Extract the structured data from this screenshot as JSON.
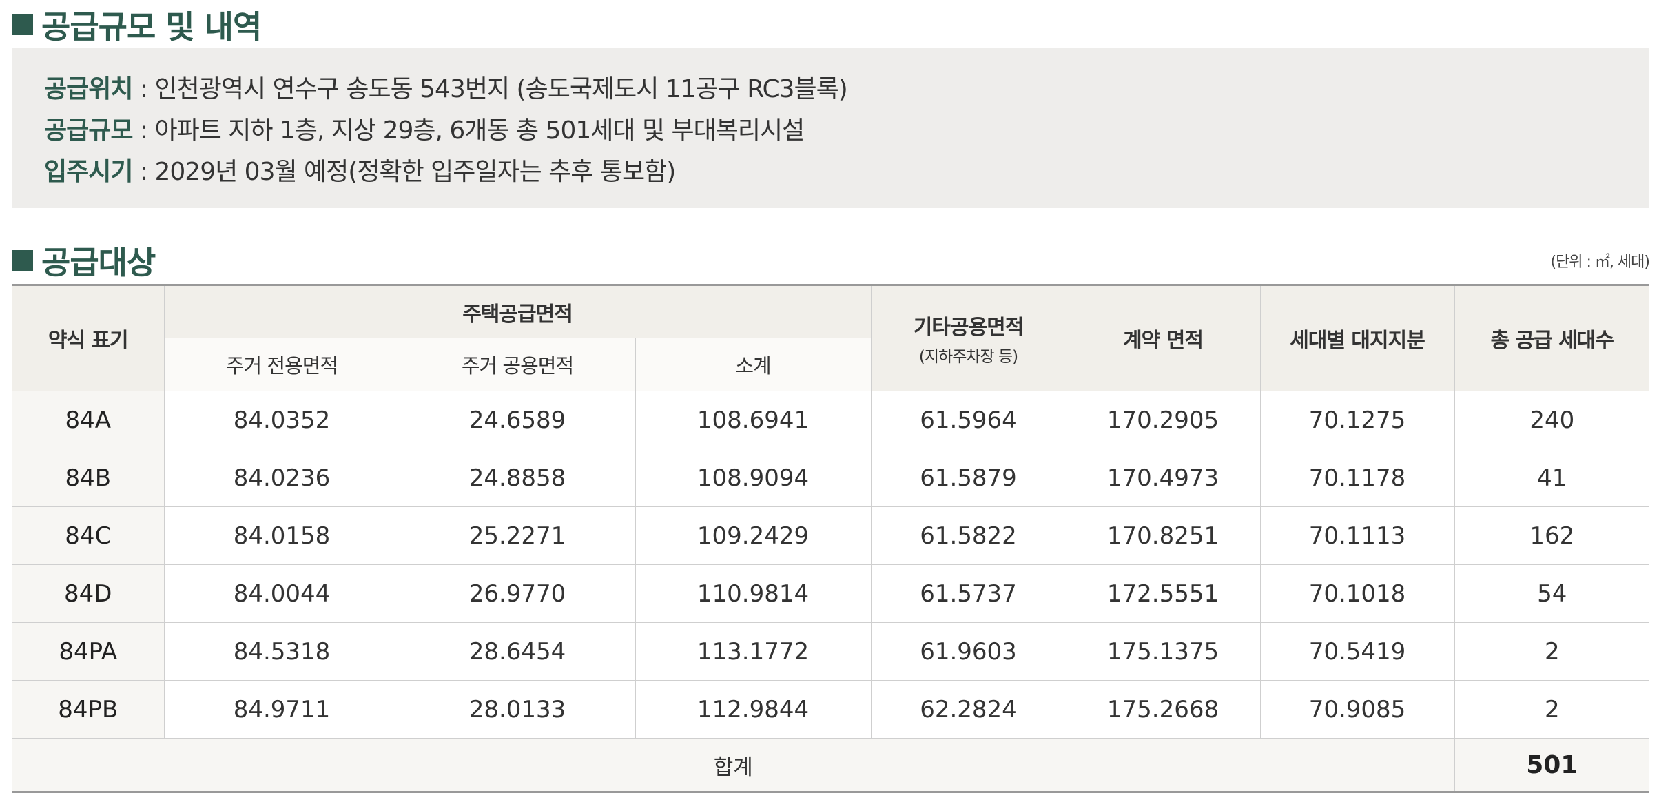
{
  "section_scale": {
    "title": "공급규모 및 내역",
    "lines": [
      {
        "label": "공급위치",
        "sep": " : ",
        "value": "인천광역시 연수구 송도동 543번지 (송도국제도시 11공구 RC3블록)"
      },
      {
        "label": "공급규모",
        "sep": " : ",
        "value": "아파트 지하 1층, 지상 29층, 6개동 총 501세대 및 부대복리시설"
      },
      {
        "label": "입주시기",
        "sep": " : ",
        "value": "2029년 03월 예정(정확한 입주일자는 추후 통보함)"
      }
    ]
  },
  "section_target": {
    "title": "공급대상",
    "unit_note": "(단위 : ㎡, 세대)"
  },
  "table": {
    "headers": {
      "type": "약식 표기",
      "housing_area": "주택공급면적",
      "exclusive": "주거 전용면적",
      "common": "주거 공용면적",
      "subtotal": "소계",
      "other_common": "기타공용면적",
      "other_common_note": "(지하주차장 등)",
      "contract": "계약 면적",
      "land_share": "세대별 대지지분",
      "households": "총 공급 세대수"
    },
    "rows": [
      {
        "type": "84A",
        "exclusive": "84.0352",
        "common": "24.6589",
        "subtotal": "108.6941",
        "other": "61.5964",
        "contract": "170.2905",
        "land": "70.1275",
        "households": "240"
      },
      {
        "type": "84B",
        "exclusive": "84.0236",
        "common": "24.8858",
        "subtotal": "108.9094",
        "other": "61.5879",
        "contract": "170.4973",
        "land": "70.1178",
        "households": "41"
      },
      {
        "type": "84C",
        "exclusive": "84.0158",
        "common": "25.2271",
        "subtotal": "109.2429",
        "other": "61.5822",
        "contract": "170.8251",
        "land": "70.1113",
        "households": "162"
      },
      {
        "type": "84D",
        "exclusive": "84.0044",
        "common": "26.9770",
        "subtotal": "110.9814",
        "other": "61.5737",
        "contract": "172.5551",
        "land": "70.1018",
        "households": "54"
      },
      {
        "type": "84PA",
        "exclusive": "84.5318",
        "common": "28.6454",
        "subtotal": "113.1772",
        "other": "61.9603",
        "contract": "175.1375",
        "land": "70.5419",
        "households": "2"
      },
      {
        "type": "84PB",
        "exclusive": "84.9711",
        "common": "28.0133",
        "subtotal": "112.9844",
        "other": "62.2824",
        "contract": "175.2668",
        "land": "70.9085",
        "households": "2"
      }
    ],
    "total": {
      "label": "합계",
      "households": "501"
    }
  },
  "colors": {
    "accent": "#2e5a4e",
    "info_bg": "#eeedeb",
    "header_bg": "#f1efea"
  }
}
